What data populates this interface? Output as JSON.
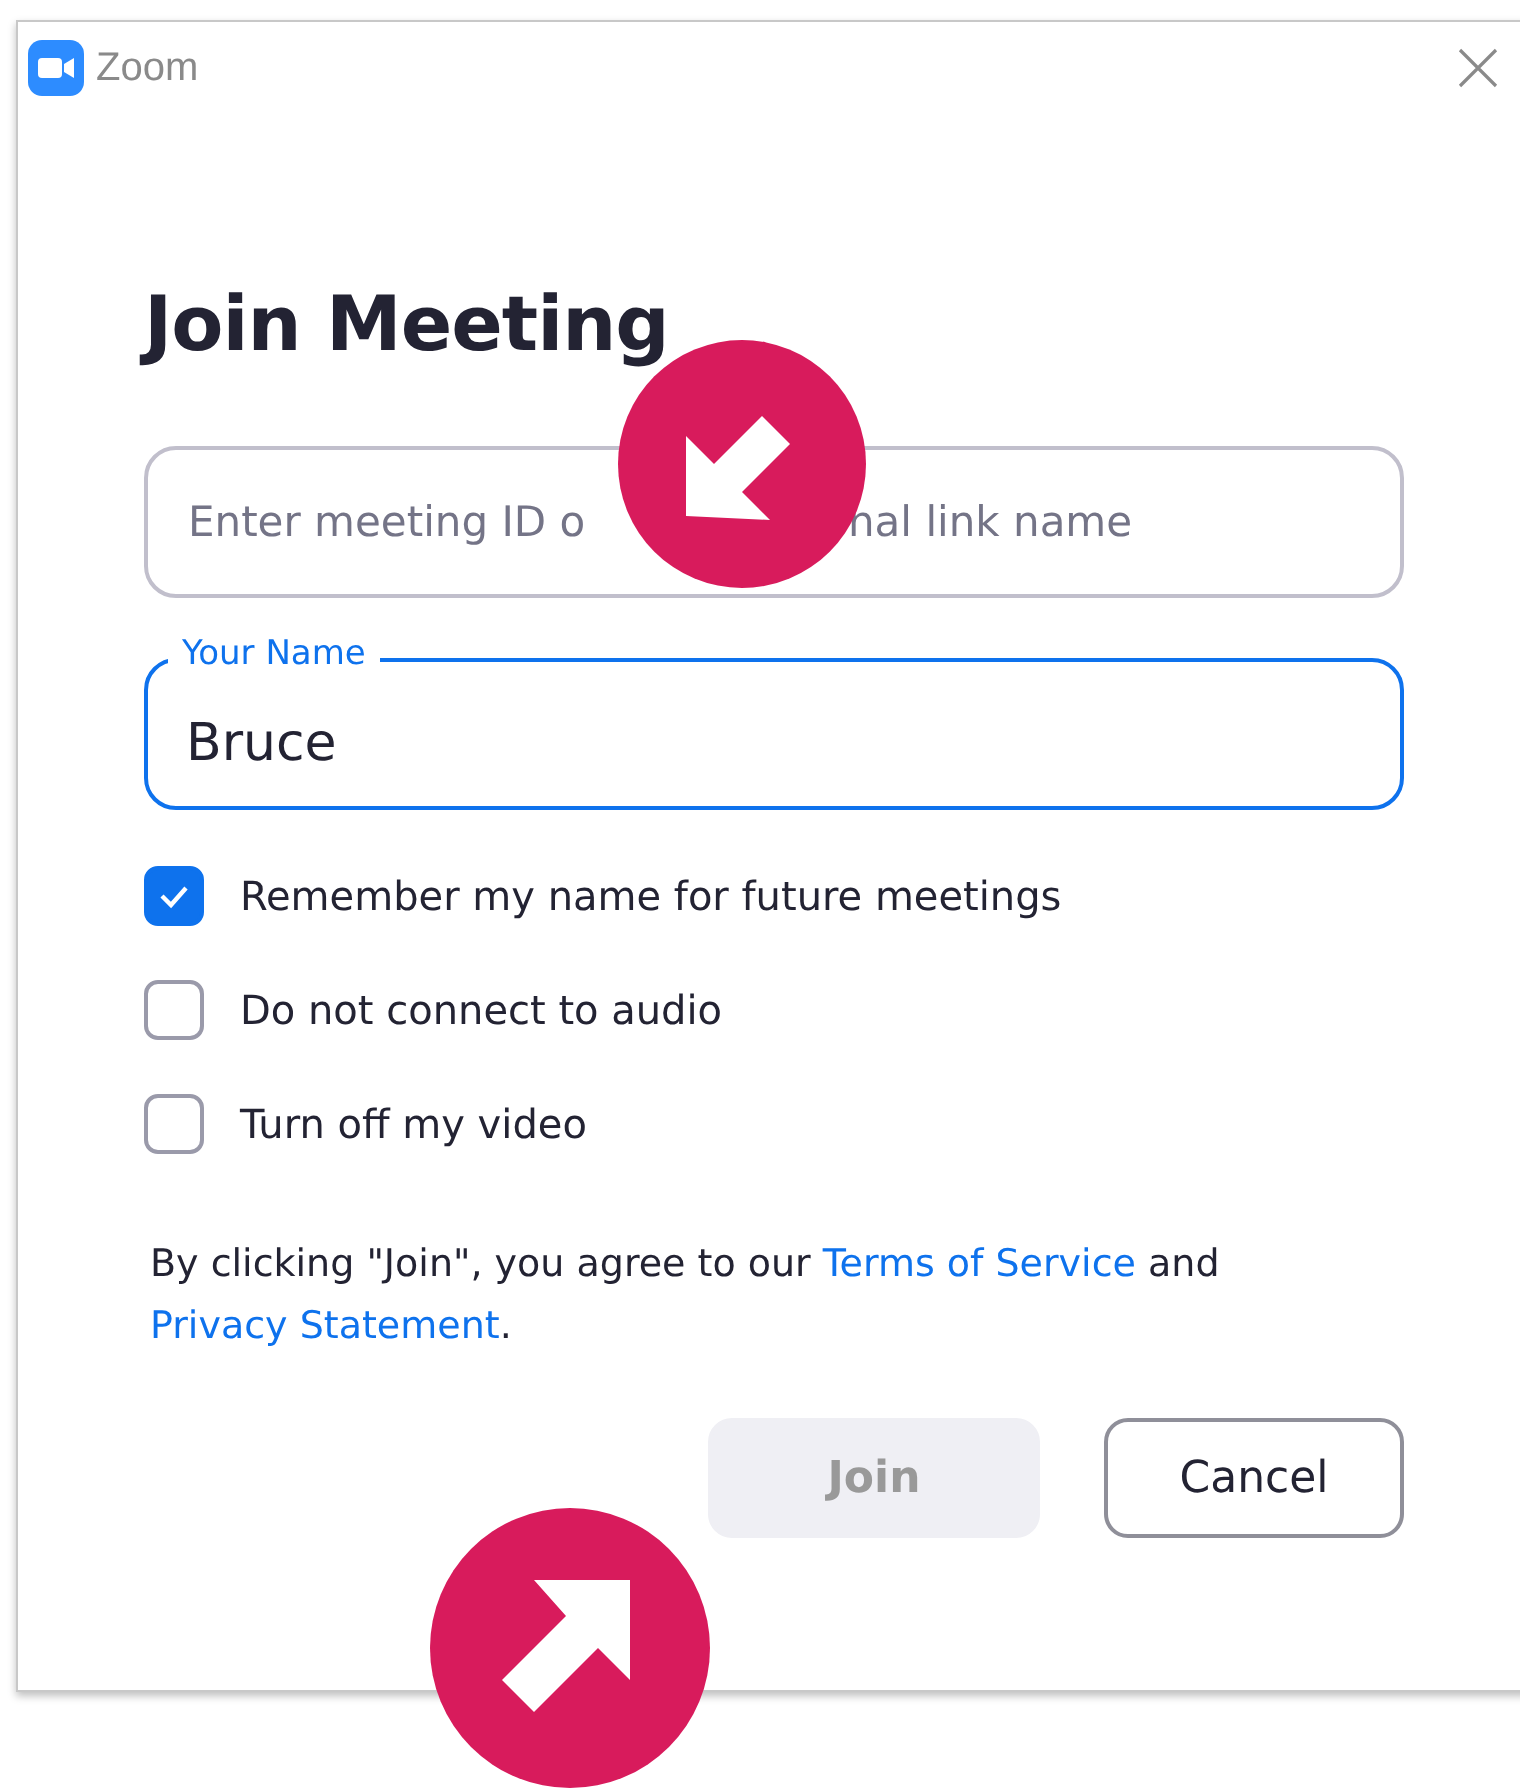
{
  "window": {
    "title": "Zoom"
  },
  "heading": "Join Meeting",
  "meeting_field": {
    "placeholder": [
      "Enter meeting ID o",
      "nal link name"
    ]
  },
  "name_field": {
    "label": "Your Name",
    "value": "Bruce",
    "focused": true
  },
  "options": [
    {
      "label": "Remember my name for future meetings",
      "checked": true
    },
    {
      "label": "Do not connect to audio",
      "checked": false
    },
    {
      "label": "Turn off my video",
      "checked": false
    }
  ],
  "agreement": [
    {
      "kind": "text",
      "text": "By clicking \"Join\", you agree to our "
    },
    {
      "kind": "link",
      "text": "Terms of Service"
    },
    {
      "kind": "text",
      "text": " and "
    },
    {
      "kind": "link",
      "text": "Privacy Statement"
    },
    {
      "kind": "text",
      "text": "."
    }
  ],
  "buttons": [
    {
      "label": "Join",
      "disabled": true
    },
    {
      "label": "Cancel",
      "disabled": false
    }
  ]
}
